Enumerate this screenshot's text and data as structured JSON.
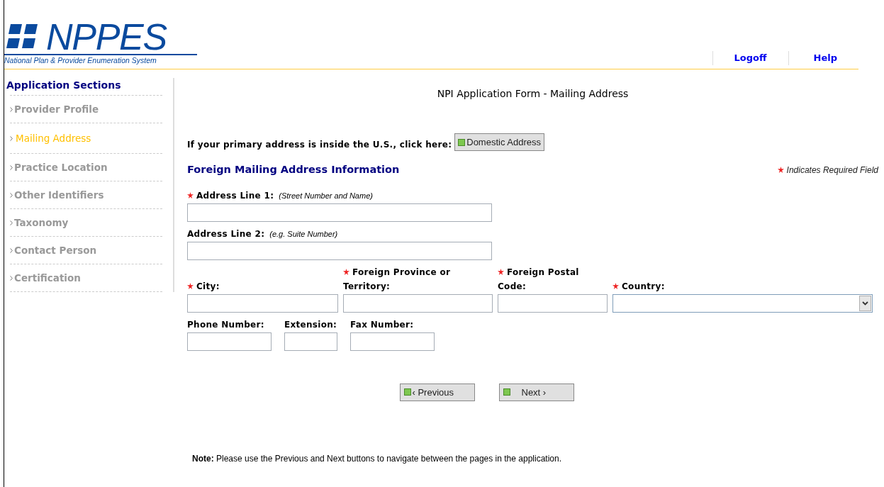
{
  "header": {
    "logo": "NPPES",
    "tagline": "National Plan & Provider Enumeration System",
    "links": [
      "Logoff",
      "Help"
    ]
  },
  "sidebar": {
    "title": "Application Sections",
    "items": [
      {
        "label": "Provider Profile",
        "selected": false
      },
      {
        "label": "Mailing Address",
        "selected": true
      },
      {
        "label": "Practice Location",
        "selected": false
      },
      {
        "label": "Other Identifiers",
        "selected": false
      },
      {
        "label": "Taxonomy",
        "selected": false
      },
      {
        "label": "Contact Person",
        "selected": false
      },
      {
        "label": "Certification",
        "selected": false
      }
    ]
  },
  "page_title": "NPI Application Form - Mailing Address",
  "domestic_prompt": "If your primary address is inside the U.S., click here:",
  "domestic_button": "Domestic Address",
  "section_title": "Foreign Mailing Address Information",
  "required_legend": "Indicates Required Field",
  "rows": [
    [
      {
        "label": "Address Line 1:",
        "hint": "(Street Number and Name)",
        "required": true,
        "kind": "text"
      }
    ],
    [
      {
        "label": "Address Line 2:",
        "hint": "(e.g. Suite Number)",
        "required": false,
        "kind": "text"
      }
    ],
    [
      {
        "label": "City:",
        "required": true,
        "kind": "text"
      },
      {
        "label": "Foreign Province or Territory:",
        "required": true,
        "kind": "text"
      },
      {
        "label": "Foreign Postal Code:",
        "required": true,
        "kind": "text"
      },
      {
        "label": "Country:",
        "required": true,
        "kind": "select"
      }
    ],
    [
      {
        "label": "Phone Number:",
        "required": false,
        "kind": "text"
      },
      {
        "label": "Extension:",
        "required": false,
        "kind": "text"
      },
      {
        "label": "Fax Number:",
        "required": false,
        "kind": "text"
      }
    ]
  ],
  "nav_buttons": [
    "‹ Previous",
    "Next ›"
  ],
  "note_label": "Note:",
  "note": "Please use the Previous and Next buttons to navigate between the pages in the application."
}
